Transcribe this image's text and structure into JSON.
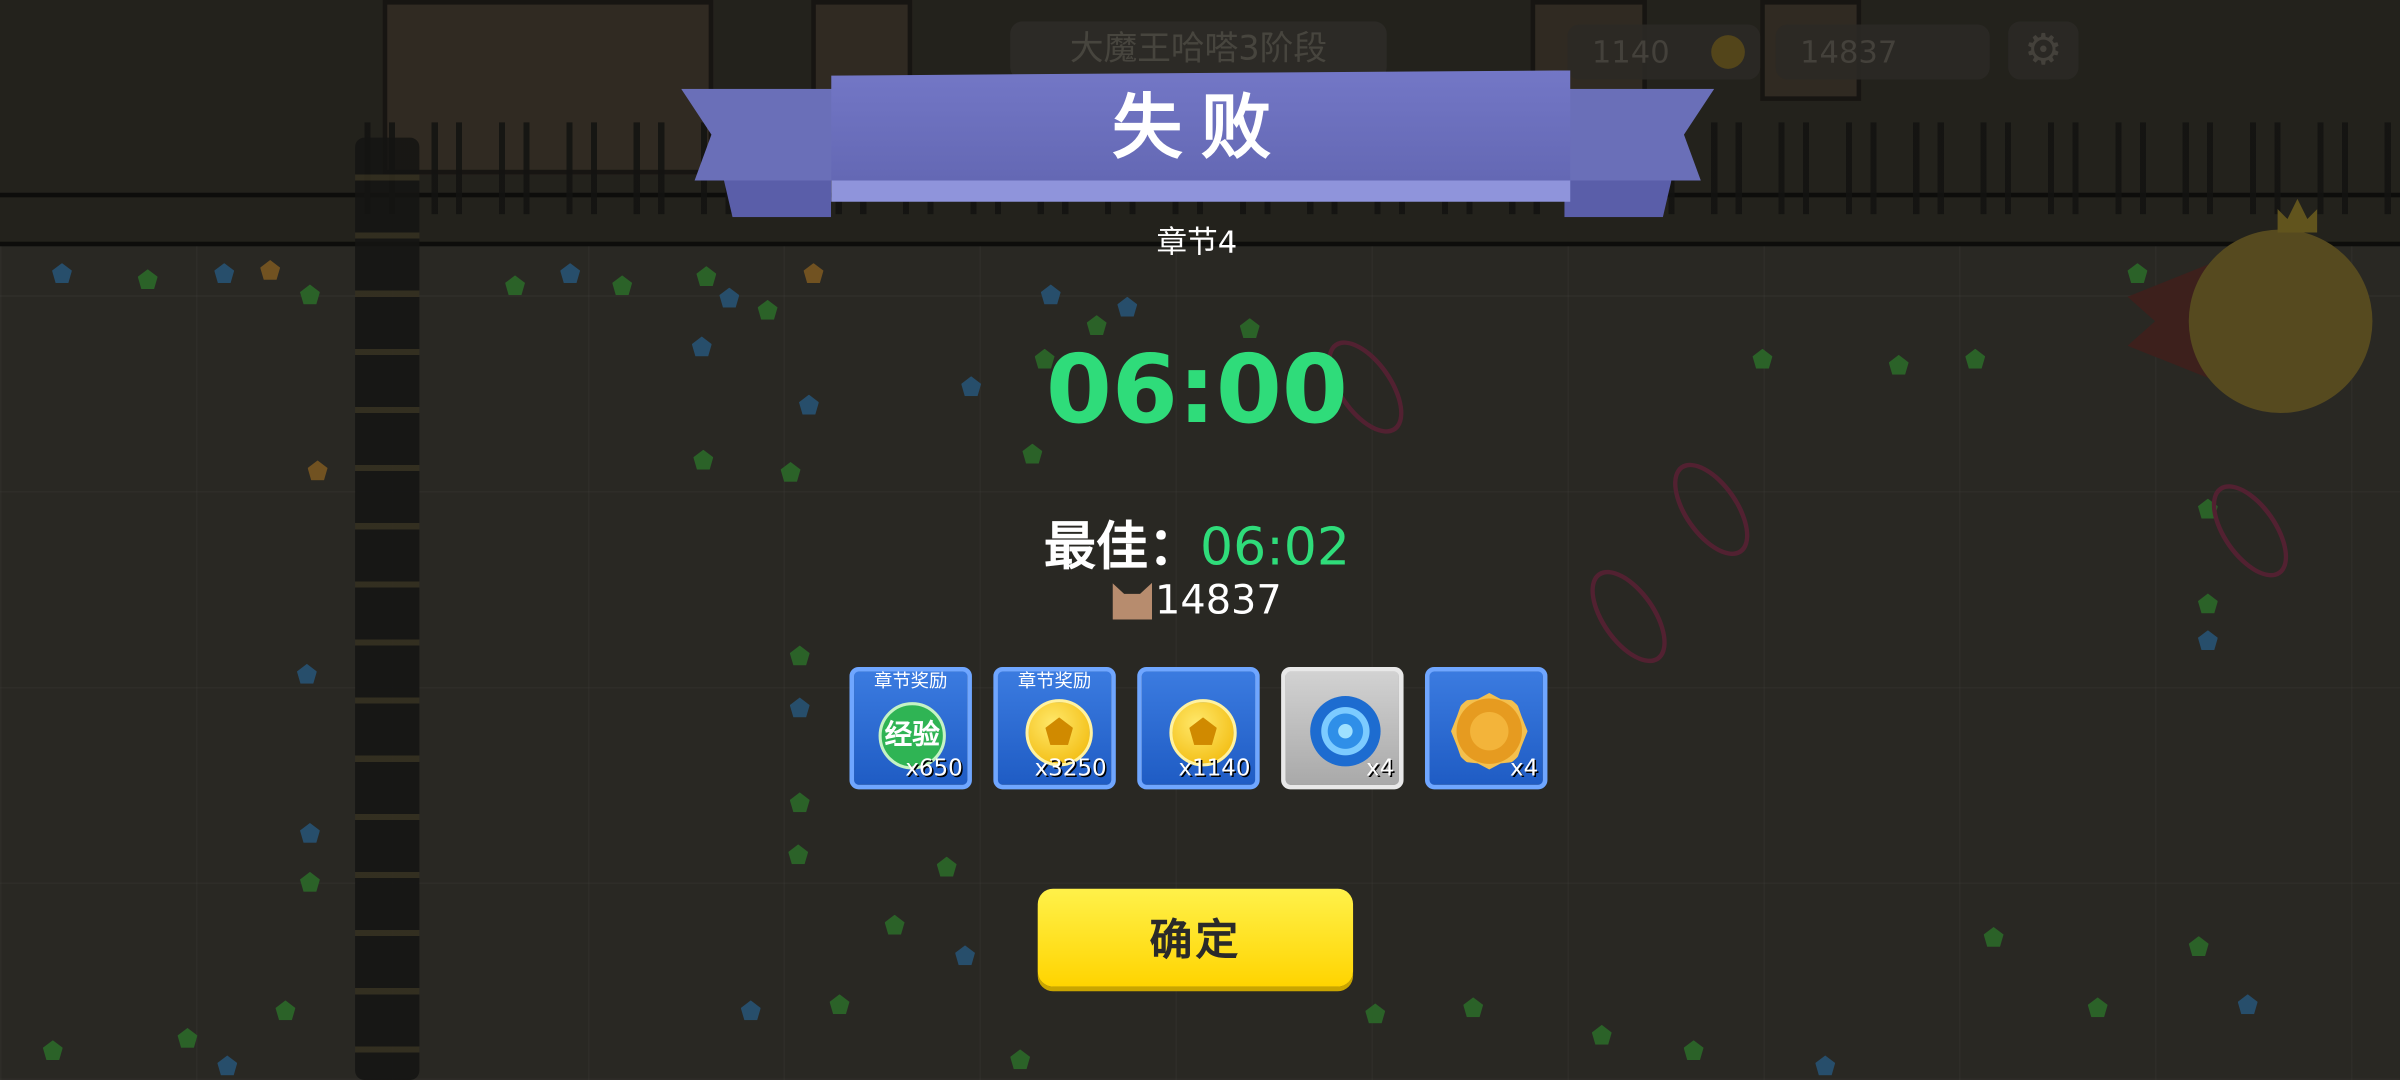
{
  "hud": {
    "stage_name": "大魔王哈嗒3阶段",
    "coins": "1140",
    "score": "14837",
    "settings_icon": "gear-icon"
  },
  "result": {
    "title": "失败",
    "chapter": "章节4",
    "time": "06:00",
    "best_label": "最佳：",
    "best_time": "06:02",
    "score": "14837",
    "score_icon": "cat-icon"
  },
  "rewards": [
    {
      "tag": "章节奖励",
      "icon": "exp-icon",
      "icon_text": "经验",
      "qty": "x650"
    },
    {
      "tag": "章节奖励",
      "icon": "coin-icon",
      "qty": "x3250"
    },
    {
      "tag": "",
      "icon": "coin-icon",
      "qty": "x1140"
    },
    {
      "tag": "",
      "icon": "swirl-orb-icon",
      "qty": "x4"
    },
    {
      "tag": "",
      "icon": "mooncake-icon",
      "qty": "x4"
    }
  ],
  "confirm_label": "确定",
  "colors": {
    "ribbon": "#6a6fb8",
    "time_green": "#2fdc7a",
    "confirm_yellow": "#ffe21f",
    "reward_blue": "#2a6ad4"
  }
}
